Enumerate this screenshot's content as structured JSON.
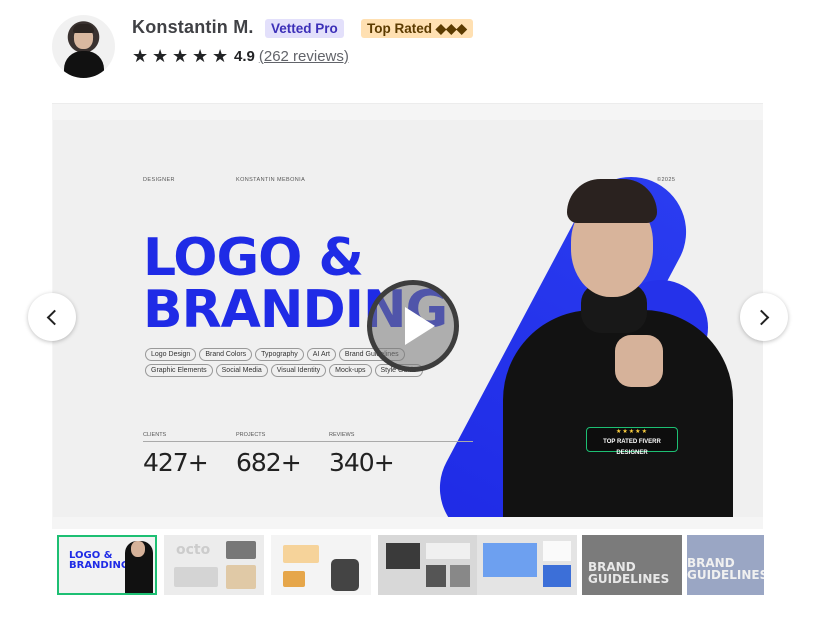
{
  "seller": {
    "name": "Konstantin M.",
    "badge_pro": "Vetted Pro",
    "badge_top": "Top Rated ◆◆◆",
    "stars": 5,
    "score": "4.9",
    "reviews": "(262 reviews)"
  },
  "slide": {
    "label_designer": "DESIGNER",
    "label_name": "KONSTANTIN MEBONIA",
    "label_year": "©2025",
    "headline_1": "LOGO &",
    "headline_2": "BRANDING",
    "chips": [
      "Logo Design",
      "Brand Colors",
      "Typography",
      "AI Art",
      "Brand Guidelines",
      "Graphic Elements",
      "Social Media",
      "Visual Identity",
      "Mock-ups",
      "Style Guide"
    ],
    "stats": [
      {
        "label": "CLIENTS",
        "value": "427+"
      },
      {
        "label": "PROJECTS",
        "value": "682+"
      },
      {
        "label": "REVIEWS",
        "value": "340+"
      }
    ],
    "badge_stars": "★★★★★",
    "badge_text": "TOP RATED FIVERR DESIGNER"
  },
  "thumbnails": [
    {
      "label": "LOGO & BRANDING",
      "active": true
    },
    {
      "label": "octo",
      "active": false
    },
    {
      "label": "",
      "active": false
    },
    {
      "label": "",
      "active": false
    },
    {
      "label": "",
      "active": false
    },
    {
      "label": "BRAND GUIDELINES",
      "active": false
    },
    {
      "label": "BRAND GUIDELINES",
      "active": false
    }
  ],
  "colors": {
    "brand_blue": "#1f2be6",
    "fiverr_green": "#1dbf73",
    "pro_bg": "#e3e0fb",
    "top_bg": "#ffe0b2"
  }
}
